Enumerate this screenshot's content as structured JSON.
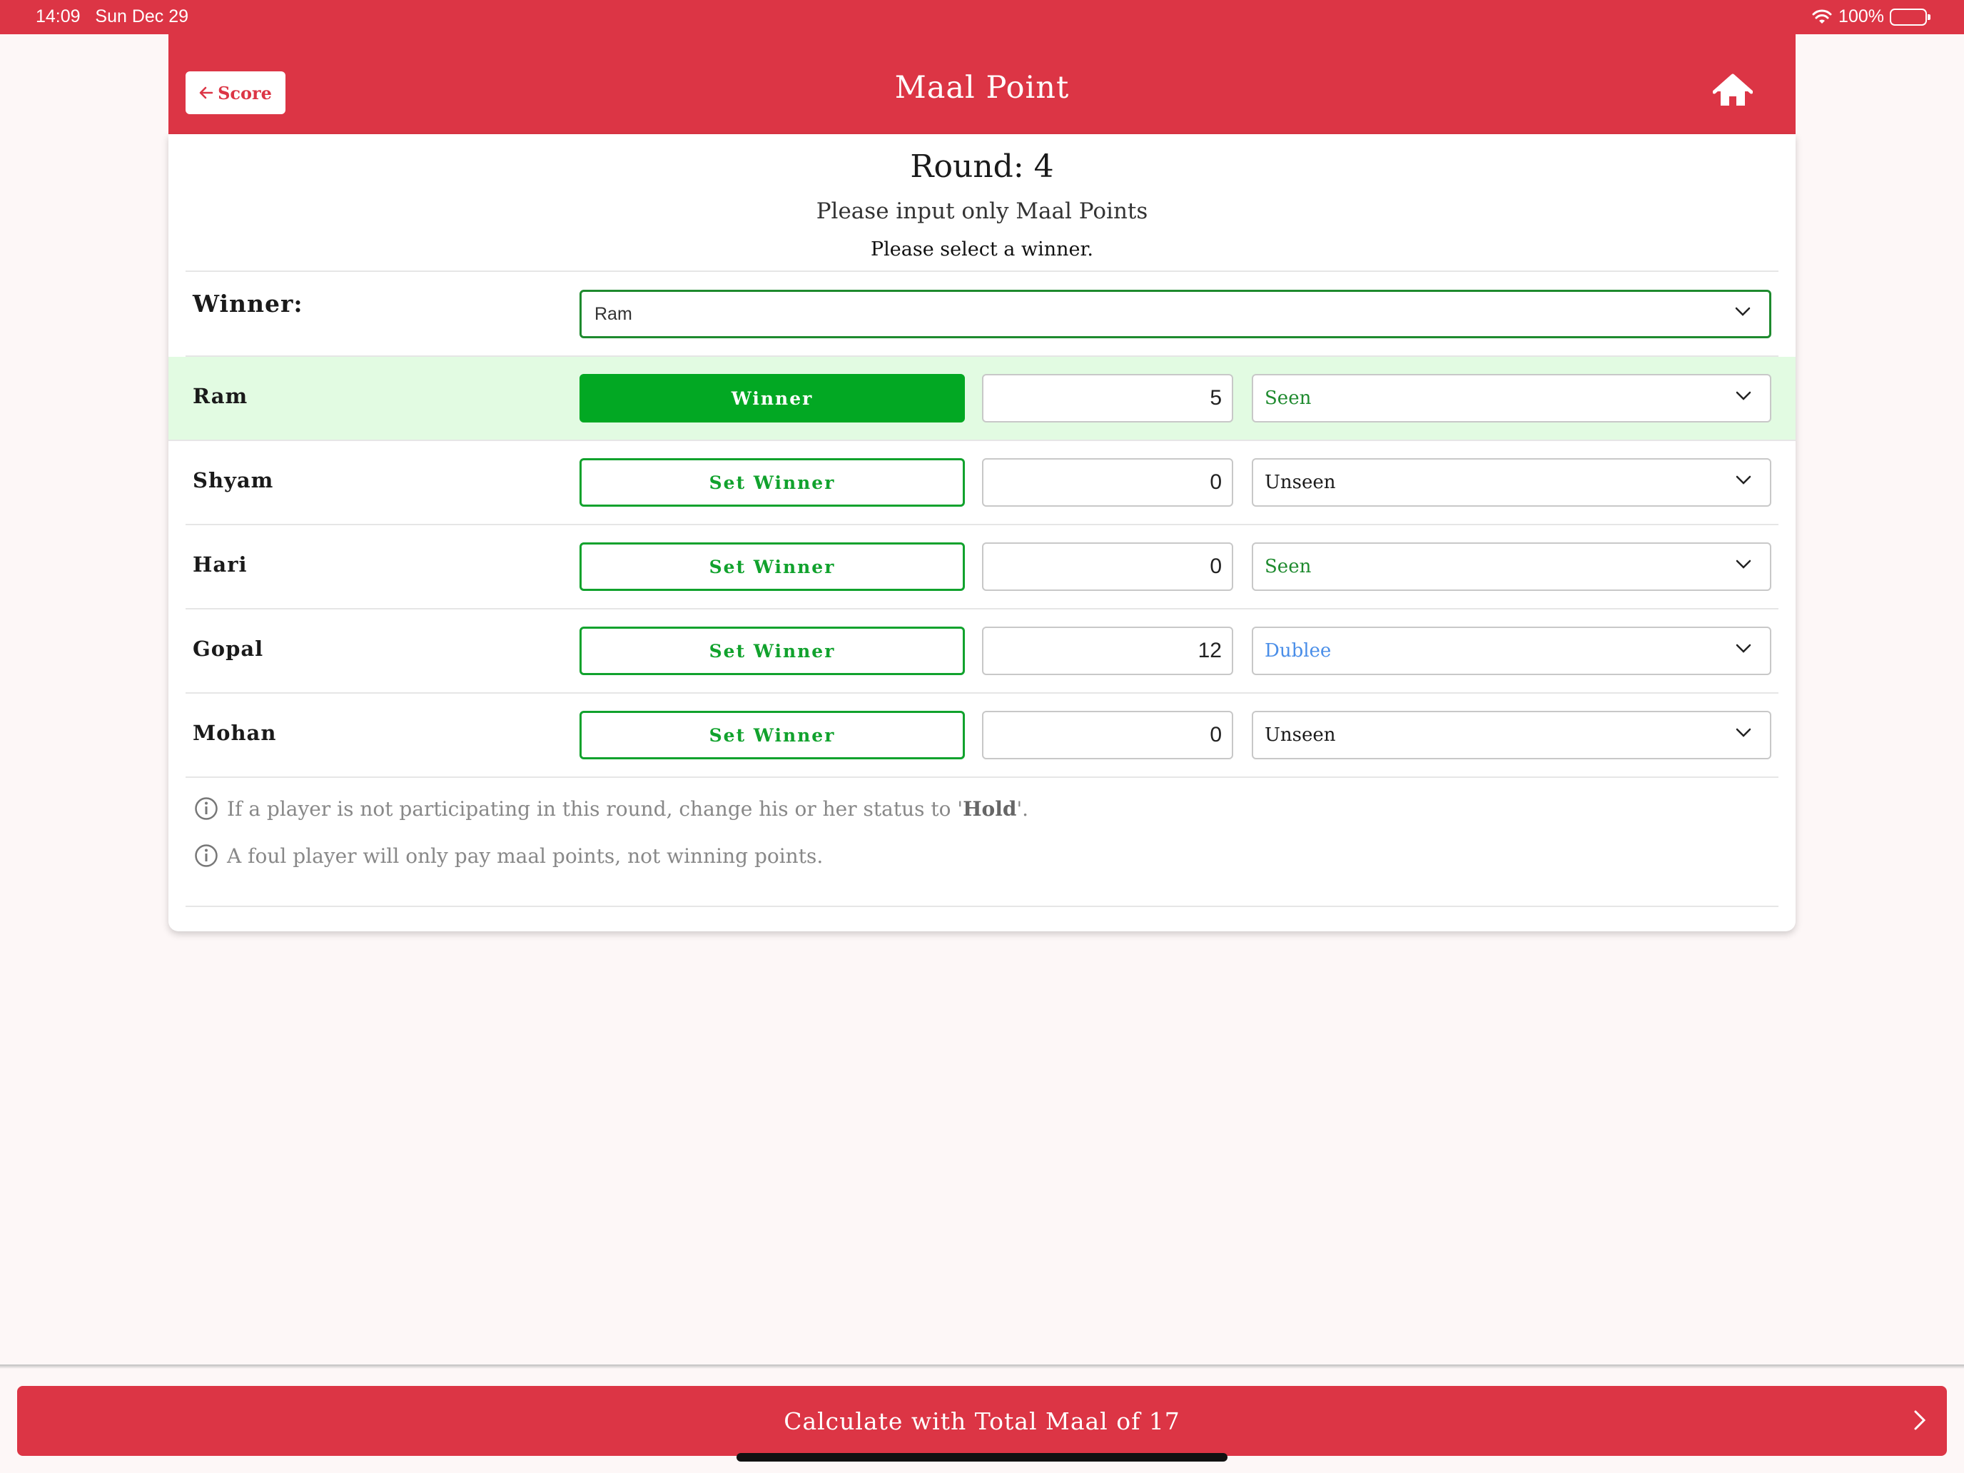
{
  "status_bar": {
    "time": "14:09",
    "date": "Sun Dec 29",
    "battery": "100%"
  },
  "header": {
    "back_label": "Score",
    "title": "Maal Point",
    "home_icon": "home-icon"
  },
  "main": {
    "round_title": "Round: 4",
    "instruction": "Please input only Maal Points",
    "select_message": "Please select a winner.",
    "winner_label": "Winner:",
    "winner_selected": "Ram"
  },
  "players": [
    {
      "name": "Ram",
      "button": "Winner",
      "points": "5",
      "status": "Seen",
      "status_color": "#1e8a2e",
      "is_winner": true
    },
    {
      "name": "Shyam",
      "button": "Set Winner",
      "points": "0",
      "status": "Unseen",
      "status_color": "#1a1a1a",
      "is_winner": false
    },
    {
      "name": "Hari",
      "button": "Set Winner",
      "points": "0",
      "status": "Seen",
      "status_color": "#1e8a2e",
      "is_winner": false
    },
    {
      "name": "Gopal",
      "button": "Set Winner",
      "points": "12",
      "status": "Dublee",
      "status_color": "#4a8ee8",
      "is_winner": false
    },
    {
      "name": "Mohan",
      "button": "Set Winner",
      "points": "0",
      "status": "Unseen",
      "status_color": "#1a1a1a",
      "is_winner": false
    }
  ],
  "notes": {
    "hold_prefix": "If a player is not participating in this round, change his or her status to '",
    "hold_word": "Hold",
    "hold_suffix": "'.",
    "foul": "A foul player will only pay maal points, not winning points."
  },
  "footer": {
    "calculate_label": "Calculate with Total Maal of 17"
  },
  "colors": {
    "accent": "#dc3545",
    "winner_green": "#02a823",
    "highlight_row": "#e2fbe2"
  }
}
